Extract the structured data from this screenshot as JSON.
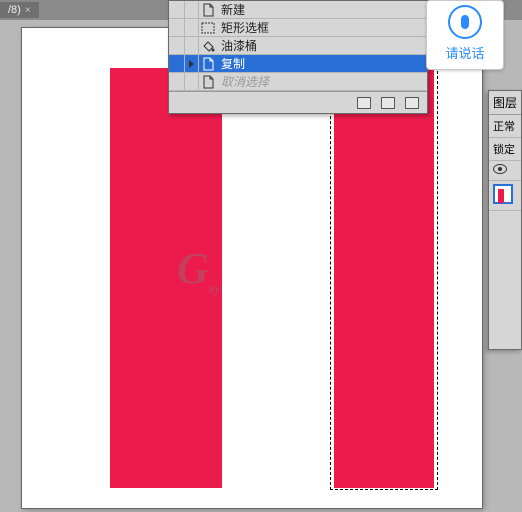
{
  "tab": {
    "label": "/8)",
    "close": "×"
  },
  "watermark": {
    "main": "G",
    "sub": "sy"
  },
  "history": {
    "items": [
      {
        "label": "新建",
        "icon": "document-icon"
      },
      {
        "label": "矩形选框",
        "icon": "marquee-icon"
      },
      {
        "label": "油漆桶",
        "icon": "paint-bucket-icon"
      },
      {
        "label": "复制",
        "icon": "document-icon",
        "selected": true,
        "playing": true
      },
      {
        "label": "取消选择",
        "icon": "document-icon",
        "disabled": true
      }
    ]
  },
  "voice": {
    "label": "请说话"
  },
  "layers": {
    "title": "图层",
    "mode": "正常",
    "lock": "锁定"
  }
}
